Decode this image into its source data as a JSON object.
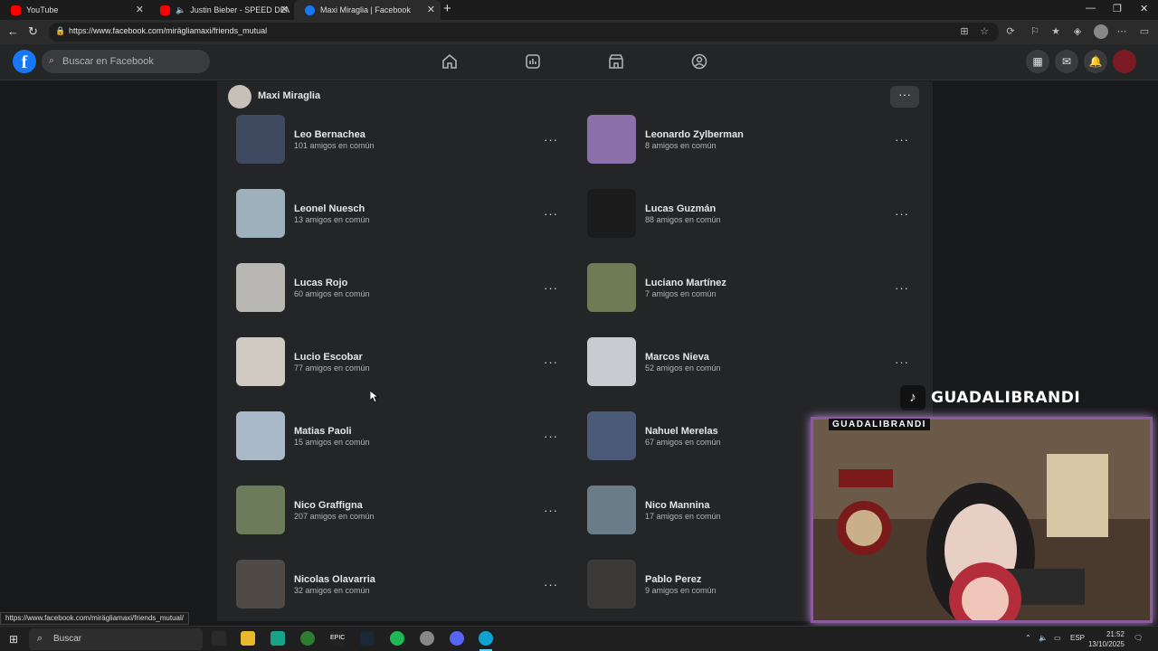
{
  "browser": {
    "tabs": [
      {
        "label": "YouTube",
        "icon": "youtube-icon",
        "color": "#ff0000"
      },
      {
        "label": "Justin Bieber - SPEED DEMO",
        "icon": "youtube-icon",
        "color": "#ff0000"
      },
      {
        "label": "Maxi Miraglia | Facebook",
        "icon": "facebook-icon",
        "color": "#1877f2"
      }
    ],
    "url": "https://www.facebook.com/mirägliamaxi/friends_mutual",
    "status_link": "https://www.facebook.com/mirägliamaxi/friends_mutual/"
  },
  "facebook": {
    "search_placeholder": "Buscar en Facebook",
    "profile_name": "Maxi Miraglia",
    "friends": [
      {
        "name": "Leo Bernachea",
        "mutual": "101 amigos en común",
        "color": "#3f4960"
      },
      {
        "name": "Leonardo Zylberman",
        "mutual": "8 amigos en común",
        "color": "#8a6fa8"
      },
      {
        "name": "Leonel Nuesch",
        "mutual": "13 amigos en común",
        "color": "#9fb0bd"
      },
      {
        "name": "Lucas Guzmán",
        "mutual": "88 amigos en común",
        "color": "#1c1c1c"
      },
      {
        "name": "Lucas Rojo",
        "mutual": "60 amigos en común",
        "color": "#b9b7b3"
      },
      {
        "name": "Luciano Martínez",
        "mutual": "7 amigos en común",
        "color": "#6e7b55"
      },
      {
        "name": "Lucio Escobar",
        "mutual": "77 amigos en común",
        "color": "#cfc9c2"
      },
      {
        "name": "Marcos Nieva",
        "mutual": "52 amigos en común",
        "color": "#c8ccd1"
      },
      {
        "name": "Matias Paoli",
        "mutual": "15 amigos en común",
        "color": "#a9b9c8"
      },
      {
        "name": "Nahuel Merelas",
        "mutual": "67 amigos en común",
        "color": "#4a5a77"
      },
      {
        "name": "Nico Graffigna",
        "mutual": "207 amigos en común",
        "color": "#6c7b5a"
      },
      {
        "name": "Nico Mannina",
        "mutual": "17 amigos en común",
        "color": "#6a7c88"
      },
      {
        "name": "Nicolas Olavarria",
        "mutual": "32 amigos en común",
        "color": "#4f4a45"
      },
      {
        "name": "Pablo Perez",
        "mutual": "9 amigos en común",
        "color": "#3b3a36"
      }
    ]
  },
  "overlay": {
    "tiktok_name": "GUADALIBRANDI",
    "webcam_label": "GUADALIBRANDI"
  },
  "taskbar": {
    "search_placeholder": "Buscar",
    "lang": "ESP",
    "time": "21:52",
    "date": "13/10/2025"
  }
}
